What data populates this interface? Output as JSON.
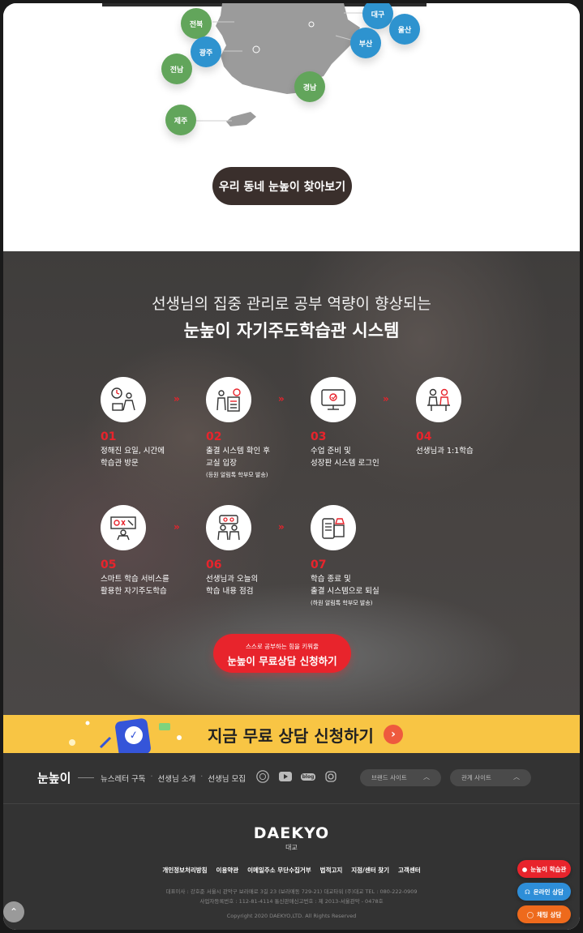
{
  "map": {
    "regions": [
      {
        "name": "전북",
        "color": "green"
      },
      {
        "name": "광주",
        "color": "blue"
      },
      {
        "name": "전남",
        "color": "green"
      },
      {
        "name": "제주",
        "color": "green"
      },
      {
        "name": "대구",
        "color": "blue"
      },
      {
        "name": "울산",
        "color": "blue"
      },
      {
        "name": "부산",
        "color": "blue"
      },
      {
        "name": "경남",
        "color": "green"
      }
    ],
    "find_button": "우리 동네 눈높이 찾아보기"
  },
  "system": {
    "subtitle": "선생님의 집중 관리로 공부 역량이 향상되는",
    "title": "눈높이 자기주도학습관 시스템",
    "steps": [
      {
        "num": "01",
        "desc": "정해진 요일, 시간에\n학습관 방문",
        "note": "",
        "icon": "student-arrival-icon"
      },
      {
        "num": "02",
        "desc": "출결 시스템 확인 후\n교실 입장",
        "note": "(등원 알림톡 학부모 발송)",
        "icon": "attendance-check-icon"
      },
      {
        "num": "03",
        "desc": "수업 준비 및\n성장판 시스템 로그인",
        "note": "",
        "icon": "computer-login-icon"
      },
      {
        "num": "04",
        "desc": "선생님과 1:1학습",
        "note": "",
        "icon": "one-on-one-icon"
      },
      {
        "num": "05",
        "desc": "스마트 학습 서비스를\n활용한 자기주도학습",
        "note": "",
        "icon": "smart-learning-icon"
      },
      {
        "num": "06",
        "desc": "선생님과 오늘의\n학습 내용 점검",
        "note": "",
        "icon": "review-icon"
      },
      {
        "num": "07",
        "desc": "학습 종료 및\n출결 시스템으로 퇴실",
        "note": "(하원 알림톡 학부모 발송)",
        "icon": "checkout-icon"
      }
    ],
    "cta_small": "스스로 공부하는 힘을 키워줄",
    "cta_big": "눈높이 무료상담 신청하기"
  },
  "banner": {
    "text": "지금 무료 상담 신청하기",
    "bg_color": "#f8c544"
  },
  "footer": {
    "brand": "눈높이",
    "links": [
      "뉴스레터 구독",
      "선생님 소개",
      "선생님 모집"
    ],
    "social": [
      "award-icon",
      "youtube-icon",
      "blog-icon",
      "instagram-icon"
    ],
    "blog_label": "blog",
    "brand_site": "브랜드 사이트",
    "related_site": "관계 사이트",
    "logo": "DAEKYO",
    "logo_sub": "대교",
    "policy": [
      "개인정보처리방침",
      "이용약관",
      "이메일주소 무단수집거부",
      "법적고지",
      "지점/센터 찾기",
      "고객센터"
    ],
    "address_line1": "대표이사 : 강호준 서울시 관악구 보라매로 3길 23 (보라매동 729-21) 대교타워 (주)대교 TEL : 080-222-0909",
    "address_line2": "사업자등록번호 : 112-81-4114 통신판매신고번호 : 제 2013-서울관악 - 0478호",
    "copyright": "Copyright 2020 DAEKYO,LTD. All Rights Reserved"
  },
  "floating": [
    {
      "label": "눈높이 학습관",
      "color": "#e8242c",
      "icon": "location-icon"
    },
    {
      "label": "온라인 상담",
      "color": "#2e8ed8",
      "icon": "headset-icon"
    },
    {
      "label": "채팅 상담",
      "color": "#ee6a1c",
      "icon": "chat-icon"
    }
  ]
}
